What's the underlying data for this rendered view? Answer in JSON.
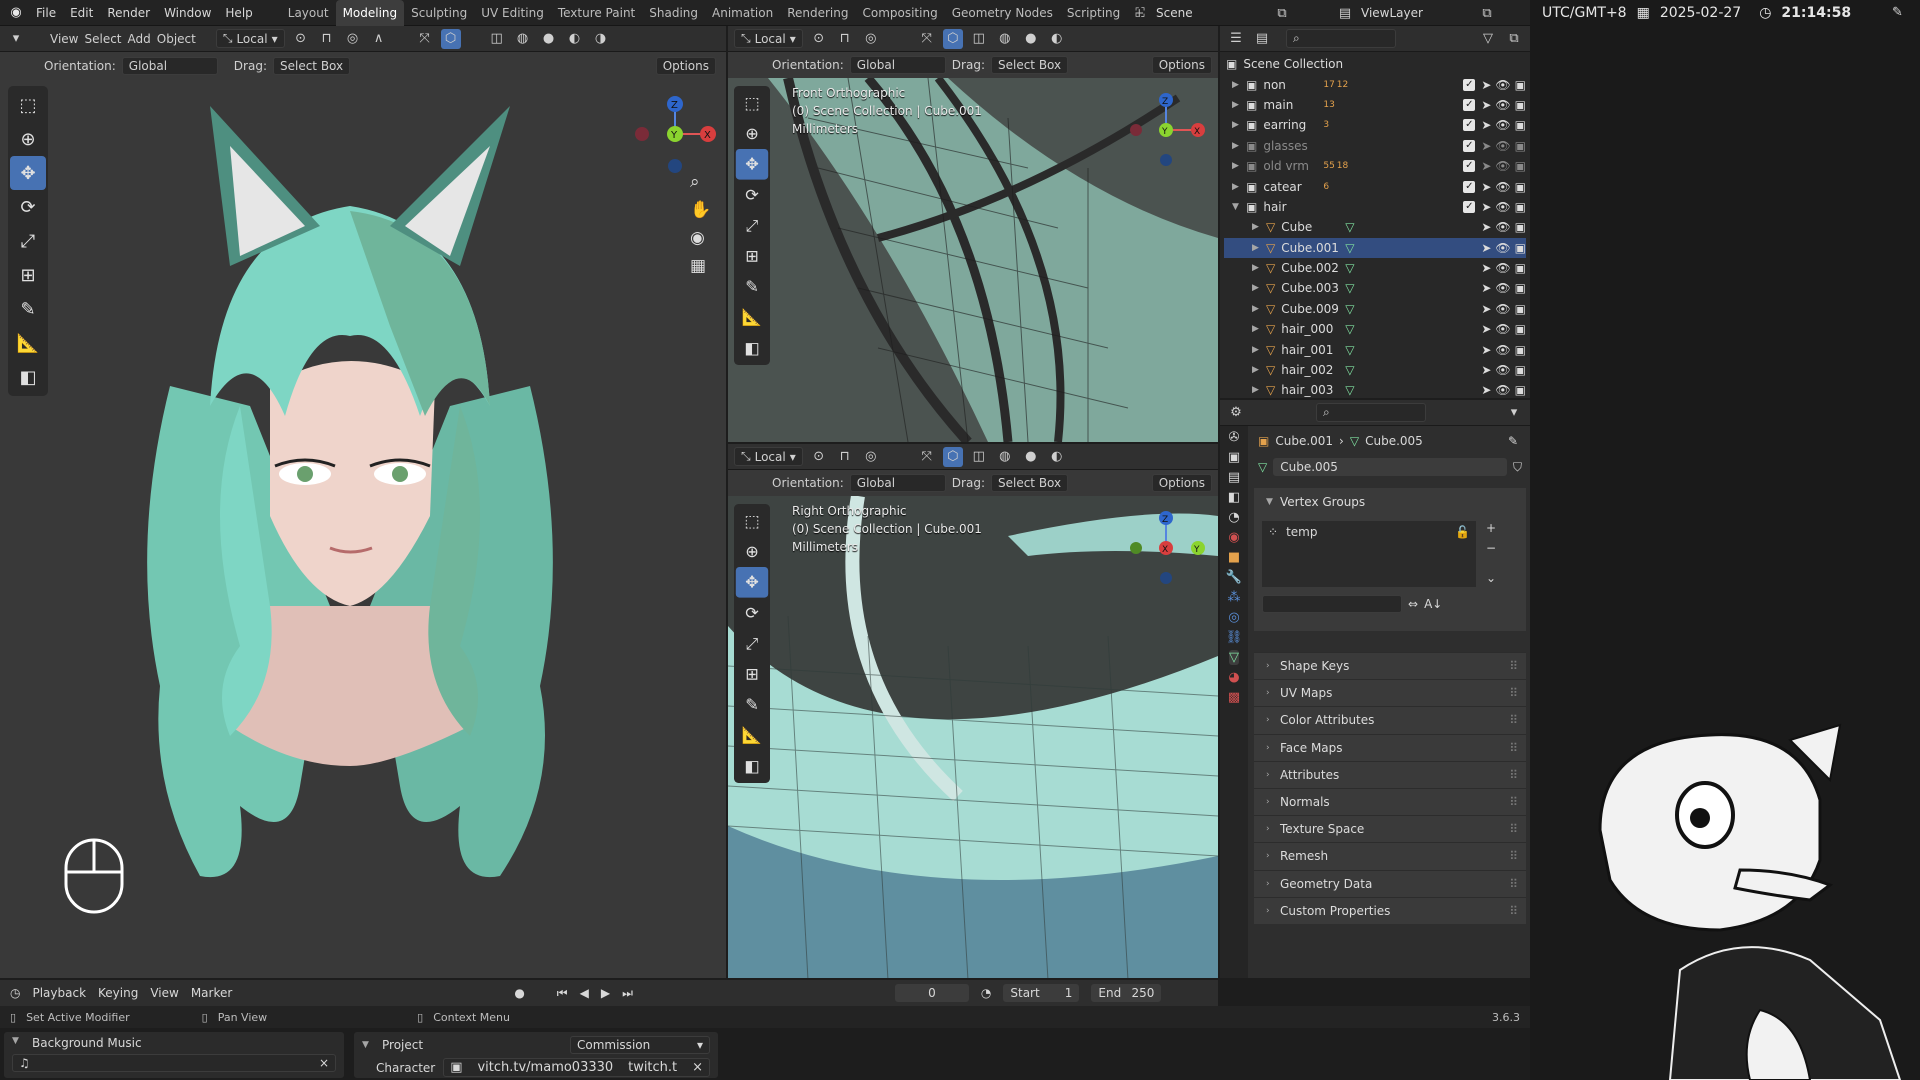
{
  "top_menu": [
    "File",
    "Edit",
    "Render",
    "Window",
    "Help"
  ],
  "workspaces": [
    "Layout",
    "Modeling",
    "Sculpting",
    "UV Editing",
    "Texture Paint",
    "Shading",
    "Animation",
    "Rendering",
    "Compositing",
    "Geometry Nodes",
    "Scripting"
  ],
  "active_workspace": "Modeling",
  "scene_name": "Scene",
  "view_layer": "ViewLayer",
  "clock": {
    "timezone": "UTC/GMT+8",
    "date": "2025-02-27",
    "time": "21:14:58"
  },
  "viewport_main": {
    "menu": [
      "View",
      "Select",
      "Add",
      "Object"
    ],
    "transform_orientation": "Local",
    "orientation_label": "Orientation:",
    "orientation_value": "Global",
    "drag_label": "Drag:",
    "drag_value": "Select Box",
    "options": "Options"
  },
  "viewport_top": {
    "transform": "Local",
    "orientation_label": "Orientation:",
    "orientation_value": "Global",
    "drag_label": "Drag:",
    "drag_value": "Select Box",
    "options": "Options",
    "view_name": "Front Orthographic",
    "collection_info": "(0) Scene Collection | Cube.001",
    "units": "Millimeters"
  },
  "viewport_bottom": {
    "transform": "Local",
    "orientation_label": "Orientation:",
    "orientation_value": "Global",
    "drag_label": "Drag:",
    "drag_value": "Select Box",
    "options": "Options",
    "view_name": "Right Orthographic",
    "collection_info": "(0) Scene Collection | Cube.001",
    "units": "Millimeters"
  },
  "outliner": {
    "root": "Scene Collection",
    "collections": [
      {
        "name": "non",
        "badges": [
          "17",
          "12"
        ],
        "dim": false
      },
      {
        "name": "main",
        "badges": [
          "13"
        ],
        "dim": false
      },
      {
        "name": "earring",
        "badges": [
          "3"
        ],
        "dim": false
      },
      {
        "name": "glasses",
        "badges": [],
        "dim": true
      },
      {
        "name": "old vrm",
        "badges": [
          "55",
          "18"
        ],
        "dim": true
      },
      {
        "name": "catear",
        "badges": [
          "6"
        ],
        "dim": false
      },
      {
        "name": "hair",
        "badges": [],
        "dim": false
      }
    ],
    "objects": [
      "Cube",
      "Cube.001",
      "Cube.002",
      "Cube.003",
      "Cube.009",
      "hair_000",
      "hair_001",
      "hair_002",
      "hair_003"
    ],
    "selected_object": "Cube.001"
  },
  "properties": {
    "breadcrumb_object": "Cube.001",
    "breadcrumb_data": "Cube.005",
    "data_name": "Cube.005",
    "vertex_groups_title": "Vertex Groups",
    "vertex_group_item": "temp",
    "sections": [
      "Shape Keys",
      "UV Maps",
      "Color Attributes",
      "Face Maps",
      "Attributes",
      "Normals",
      "Texture Space",
      "Remesh",
      "Geometry Data",
      "Custom Properties"
    ]
  },
  "timeline": {
    "menu": [
      "Playback",
      "Keying",
      "View",
      "Marker"
    ],
    "current_frame": "0",
    "start_label": "Start",
    "start": "1",
    "end_label": "End",
    "end": "250"
  },
  "status": {
    "left": "Set Active Modifier",
    "middle": "Pan View",
    "right": "Context Menu",
    "version": "3.6.3"
  },
  "bottom_panels": {
    "music_title": "Background Music",
    "project_title": "Project",
    "project_value": "Commission",
    "character_label": "Character",
    "character_value": "vitch.tv/mamo03330",
    "character_value2": "twitch.t"
  },
  "colors": {
    "accent": "#4772b3",
    "selected_row": "#334d80",
    "hair": "#7ed6c4",
    "obj_orange": "#e3a14c"
  }
}
